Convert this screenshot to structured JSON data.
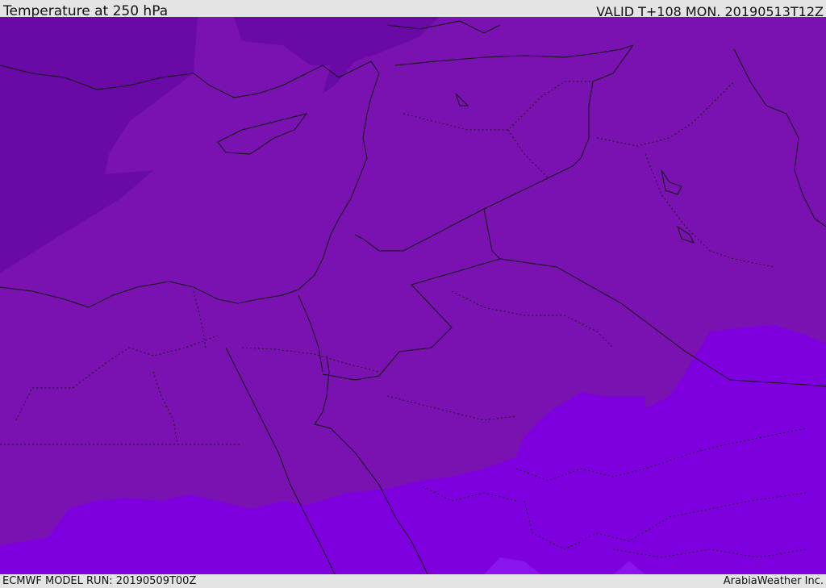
{
  "header": {
    "title": "Temperature at 250 hPa",
    "valid_time": "VALID T+108 MON. 20190513T12Z"
  },
  "footer": {
    "model_run": "ECMWF MODEL RUN: 20190509T00Z",
    "credit": "ArabiaWeather Inc."
  },
  "map": {
    "field": "temperature",
    "level": "250 hPa",
    "colors": {
      "cold_band": "#6a0aa6",
      "mid_band": "#7a12b2",
      "warm_band": "#7f00de",
      "warmest_band": "#8a14ee",
      "coastline": "#111111",
      "border": "#111111"
    }
  }
}
